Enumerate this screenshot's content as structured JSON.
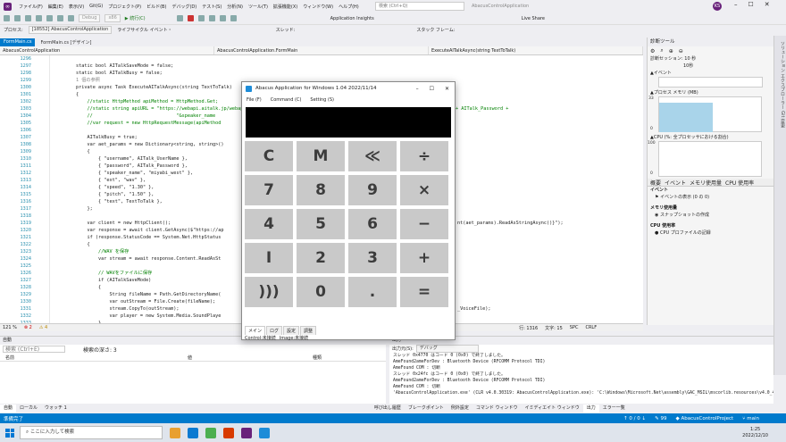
{
  "app": {
    "menu": [
      "ファイル(F)",
      "編集(E)",
      "表示(V)",
      "Git(G)",
      "プロジェクト(P)",
      "ビルド(B)",
      "デバッグ(D)",
      "テスト(S)",
      "分析(N)",
      "ツール(T)",
      "拡張機能(X)",
      "ウィンドウ(W)",
      "ヘルプ(H)"
    ],
    "search_placeholder": "検索 (Ctrl+Q)",
    "solution_title": "AbacusControlApplication",
    "user_initials": "KS",
    "live_share": "Live Share"
  },
  "toolbar": {
    "config": "Debug",
    "platform": "x86",
    "continue": "続行(C)",
    "app_insights": "Application Insights",
    "process_label": "プロセス:",
    "process_value": "[18552] AbacusControlApplication",
    "lifecycle": "ライフサイクル イベント・",
    "thread": "スレッド:",
    "stack_frame": "スタック フレーム:"
  },
  "doctabs": [
    "FormMain.cs",
    "FormMain.cs [デザイン]"
  ],
  "navbar": [
    "AbacusControlApplication",
    "AbacusControlApplication.FormMain",
    "ExecuteAITalkAsync(string TextToTalk)"
  ],
  "line_numbers": [
    "1296",
    "1297",
    "1298",
    "1299",
    "1300",
    "1301",
    "1302",
    "1303",
    "1304",
    "1305",
    "1306",
    "1307",
    "1308",
    "1309",
    "1310",
    "1311",
    "1312",
    "1313",
    "1314",
    "1315",
    "1316",
    "1317",
    "1318",
    "1319",
    "1320",
    "1321",
    "1322",
    "1323",
    "1324",
    "1325",
    "1326",
    "1327",
    "1328",
    "1329",
    "1330",
    "1331",
    "1332",
    "1333"
  ],
  "code_lines": [
    "",
    "        static bool AITalkSaveMode = false;",
    "        static bool AITalkBusy = false;",
    "        1 個の参照",
    "        private async Task ExecuteAITalkAsync(string TextToTalk)",
    "        {",
    "            //static HttpMethod apiMethod = HttpMethod.Get;",
    "            //static string apiURL = \"https://webapi.aitalk.jp/webap",
    "            //                              \"&speaker_name",
    "            //var request = new HttpRequestMessage(apiMethod",
    "",
    "            AITalkBusy = true;",
    "            var aet_params = new Dictionary<string, string>()",
    "            {",
    "                { \"username\", AITalk_UserName },",
    "                { \"password\", AITalk_Password },",
    "                { \"speaker_name\", \"miyabi_west\" },",
    "                { \"ext\", \"wav\" },",
    "                { \"speed\", \"1.30\" },",
    "                { \"pitch\", \"1.50\" },",
    "                { \"text\", TextToTalk },",
    "            };",
    "",
    "            var client = new HttpClient();",
    "            var response = await client.GetAsync($\"https://ap",
    "            if (response.StatusCode == System.Net.HttpStatus",
    "            {",
    "                //WAV を保存",
    "                var stream = await response.Content.ReadAsSt",
    "",
    "                // WAVをファイルに保存",
    "                if (AITalkSaveMode)",
    "                {",
    "                    String fileName = Path.GetDirectoryName(",
    "                    var outStream = File.Create(fileName);",
    "                    stream.CopyTo(outStream);",
    "                    var player = new System.Media.SoundPlaye",
    "                }"
  ],
  "code_right": {
    "l1302": "+ AITalk_Password +",
    "l1319": "nt(aet_params).ReadAsStringAsync()}\");",
    "l1330": "_VoiceFile);"
  },
  "editor_status": {
    "zoom": "121 %",
    "errors": "2",
    "warnings": "4",
    "line": "行: 1316",
    "col": "文字: 15",
    "spc": "SPC",
    "crlf": "CRLF"
  },
  "calculator": {
    "title": "Abacus Application for Windows 1.04 2022/11/14",
    "menu": [
      "File (F)",
      "Command (C)",
      "Setting (S)"
    ],
    "keys": [
      "C",
      "M",
      "≪",
      "÷",
      "7",
      "8",
      "9",
      "×",
      "4",
      "5",
      "6",
      "−",
      "I",
      "2",
      "3",
      "+",
      ")))",
      "0",
      ".",
      "="
    ],
    "tabs": [
      "メイン",
      "ログ",
      "設定",
      "調整"
    ],
    "status": [
      "Control:未接続",
      "Image:未接続"
    ]
  },
  "diagnostics": {
    "title": "診断ツール",
    "session": "診断セッション: 10 秒",
    "session_scale": "10秒",
    "events": "▲イベント",
    "memory": "▲プロセス メモリ (MB)",
    "memory_legend": [
      "ス.",
      "プラ.."
    ],
    "memory_axis": [
      "33",
      "0"
    ],
    "cpu": "▲CPU (%: 全プロセッサにおける割合)",
    "cpu_axis": [
      "100",
      "0"
    ],
    "tabs": [
      "概要",
      "イベント",
      "メモリ使用量",
      "CPU 使用率"
    ],
    "sec_events": "イベント",
    "events_line": "イベントの表示 (0 の 0)",
    "sec_memory": "メモリ使用量",
    "memory_line": "スナップショットの作成",
    "sec_cpu": "CPU 使用率",
    "cpu_line": "CPU プロファイルの記録",
    "side_label": "ソリューション エクスプローラー  Git 変更"
  },
  "locals": {
    "title": "自動",
    "search": "検索 (Ctrl+E)",
    "search_depth": "検索の深さ: 3",
    "columns": [
      "名前",
      "値",
      "種類"
    ],
    "tabs": [
      "自動",
      "ローカル",
      "ウォッチ 1"
    ]
  },
  "output": {
    "title": "出力",
    "source_label": "出力元(S):",
    "source": "デバッグ",
    "lines": [
      "スレッド 0x4770 はコード 0 (0x0) で終了しました。",
      "AmeFound2ameForDev : Bluetooth Device (RFCOMM Protocol TDI)",
      "AmeFound COM : 切断",
      "スレッド 0x24fc はコード 0 (0x0) で終了しました。",
      "AmeFound2ameForDev : Bluetooth Device (RFCOMM Protocol TDI)",
      "AmeFound COM : 切断",
      "'AbacusControlApplication.exe' (CLR v4.0.30319: AbacusControlApplication.exe): 'C:\\Windows\\Microsoft.Net\\assembly\\GAC_MSIL\\mscorlib.resources\\v4.0_4.0.0"
    ],
    "tabs": [
      "呼び出し履歴",
      "ブレークポイント",
      "例外設定",
      "コマンド ウィンドウ",
      "イミディエイト ウィンドウ",
      "出力",
      "エラー一覧"
    ]
  },
  "vs_status": {
    "ready": "準備完了",
    "git": "↑ 0 / 0 ↓",
    "branch_count": "99",
    "project": "AbacusControlProject",
    "branch": "main"
  },
  "taskbar": {
    "search": "ここに入力して検索",
    "time": "1:25",
    "date": "2022/12/10"
  },
  "colors": {
    "accent": "#007acc",
    "key_bg": "#c9c9c9",
    "key_fg": "#3c3c3c",
    "vs_purple": "#68217a"
  }
}
